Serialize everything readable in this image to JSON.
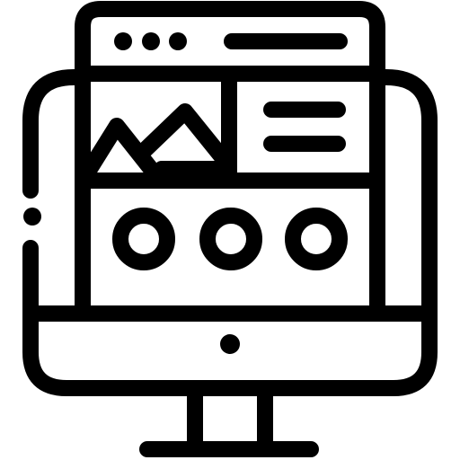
{
  "icon": {
    "name": "desktop-web-layout-icon",
    "stroke_color": "#000000",
    "background_color": "#ffffff",
    "parts": [
      "monitor",
      "browser-window",
      "window-controls",
      "address-bar",
      "image-placeholder",
      "text-lines",
      "circle-buttons",
      "power-button",
      "stand"
    ]
  }
}
